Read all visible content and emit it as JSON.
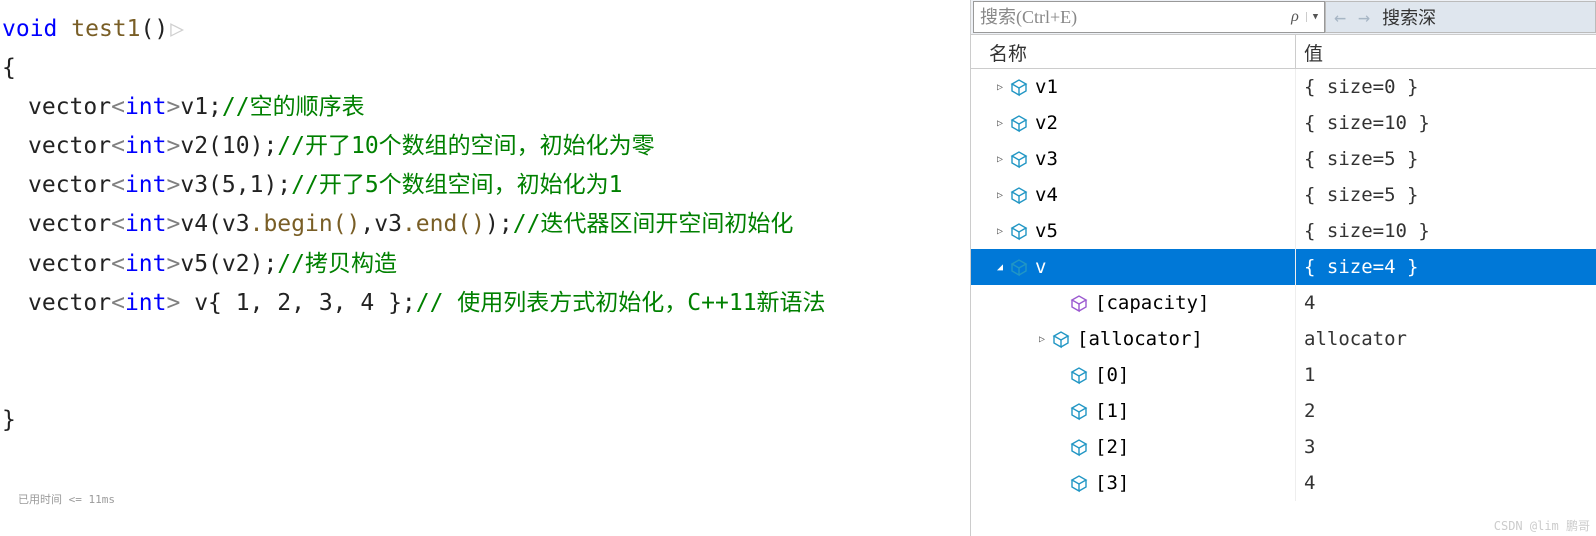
{
  "search": {
    "placeholder": "搜索(Ctrl+E)",
    "nav_label": "搜索深"
  },
  "headers": {
    "name": "名称",
    "value": "值"
  },
  "editor": {
    "line1_kw": "void",
    "line1_fn": "test1",
    "line1_paren": "()",
    "l3_pre": "vector",
    "l3_t": "int",
    "l3_v": "v1;",
    "l3_c": "//空的顺序表",
    "l4_v": "v2(10);",
    "l4_c": "//开了10个数组的空间，初始化为零",
    "l5_v": "v3(5,1);",
    "l5_c": "//开了5个数组空间，初始化为1",
    "l6_v": "v4(v3",
    "l6_fn1": ".begin()",
    "l6_mid": ",v3",
    "l6_fn2": ".end()",
    "l6_end": ");",
    "l6_c": "//迭代器区间开空间初始化",
    "l7_v": "v5(v2);",
    "l7_c": "//拷贝构造",
    "l8_v": " v{ 1, 2, 3, 4 };",
    "l8_c": "// 使用列表方式初始化，C++11新语法",
    "timing": "已用时间 <= 11ms"
  },
  "watch": {
    "rows": [
      {
        "name": "v1",
        "value": "{ size=0 }"
      },
      {
        "name": "v2",
        "value": "{ size=10 }"
      },
      {
        "name": "v3",
        "value": "{ size=5 }"
      },
      {
        "name": "v4",
        "value": "{ size=5 }"
      },
      {
        "name": "v5",
        "value": "{ size=10 }"
      }
    ],
    "selected": {
      "name": "v",
      "value": "{ size=4 }"
    },
    "children": [
      {
        "name": "[capacity]",
        "value": "4",
        "icon": "purple"
      },
      {
        "name": "[allocator]",
        "value": "allocator",
        "icon": "blue",
        "expandable": true
      },
      {
        "name": "[0]",
        "value": "1",
        "icon": "blue"
      },
      {
        "name": "[1]",
        "value": "2",
        "icon": "blue"
      },
      {
        "name": "[2]",
        "value": "3",
        "icon": "blue"
      },
      {
        "name": "[3]",
        "value": "4",
        "icon": "blue"
      }
    ]
  },
  "watermark": "CSDN @lim 鹏哥"
}
